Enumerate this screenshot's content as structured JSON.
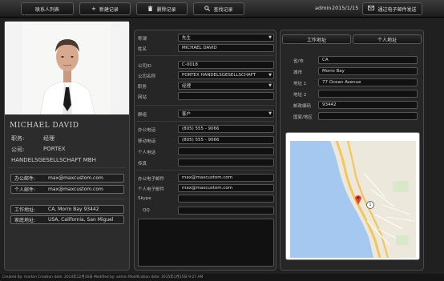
{
  "toolbar": {
    "contacts_list": "联系人列表",
    "new_record": "新建记录",
    "delete_record": "删除记录",
    "find_record": "查找记录",
    "user": "admin",
    "date": "2015/1/15",
    "send_email": "通过电子邮件发送"
  },
  "left": {
    "name": "MICHAEL DAVID",
    "title_label": "职务:",
    "title_value": "经理",
    "company_label": "公司:",
    "company_value": "PORTEX",
    "company_full": "HANDELSGESELLSCHAFT MBH",
    "office_email_label": "办公邮件:",
    "office_email": "max@maxcustom.com",
    "personal_email_label": "个人邮件:",
    "personal_email": "max@maxcustom.com",
    "work_address_label": "工作地址:",
    "work_address": "CA, Morro Bay 93442",
    "home_address_label": "家庭地址:",
    "home_address": "USA, California, San Miguel"
  },
  "form": {
    "salutation_label": "称谓",
    "salutation_value": "先生",
    "name_label": "姓名",
    "name_value": "MICHAEL DAVID",
    "company_id_label": "公司ID",
    "company_id_value": "C-0018",
    "company_name_label": "公司名称",
    "company_name_value": "PORTEX HANDELSGESELLSCHAFT",
    "position_label": "职务",
    "position_value": "经理",
    "website_label": "网站",
    "website_value": "",
    "category_label": "群组",
    "category_value": "客户",
    "office_phone_label": "办公电话",
    "office_phone_value": "(805) 555 - 9066",
    "mobile_label": "移动电话",
    "mobile_value": "(805) 555 - 9066",
    "personal_phone_label": "个人电话",
    "personal_phone_value": "",
    "fax_label": "传真",
    "fax_value": "",
    "office_email_label": "办公电子邮件",
    "office_email_value": "max@maxcustom.com",
    "personal_email_label": "个人电子邮件",
    "personal_email_value": "max@maxcustom.com",
    "skype_label": "Skype",
    "skype_value": "",
    "qq_label": "QQ",
    "qq_value": ""
  },
  "address": {
    "tab_work": "工作地址",
    "tab_personal": "个人地址",
    "state_label": "省/市",
    "state_value": "CA",
    "city_label": "城市",
    "city_value": "Morro Bay",
    "addr1_label": "地址 1",
    "addr1_value": "77 Ocean Avenue",
    "addr2_label": "地址 2",
    "addr2_value": "",
    "zip_label": "邮政编码",
    "zip_value": "93442",
    "country_label": "国家/地区",
    "country_value": ""
  },
  "map": {
    "marker_label": "1"
  },
  "footer": {
    "text": "Created By: marton  Creation date: 2014年12月16日  Modified by: admin  Modification date: 2015年1月15日 9:27 AM"
  },
  "colors": {
    "toolbar_bg": "#2a2a2a",
    "panel_bg": "#2c2c2c",
    "field_bg": "#111111",
    "map_water": "#a4c8ef",
    "map_land": "#ece8dc",
    "map_road": "#f4c55a",
    "marker": "#e0483a"
  }
}
